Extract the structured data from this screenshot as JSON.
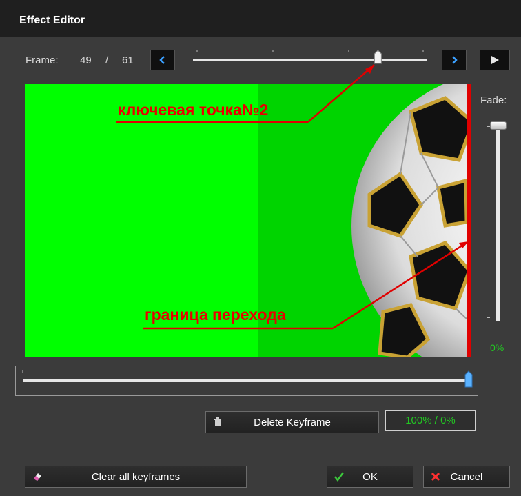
{
  "window": {
    "title": "Effect Editor"
  },
  "frame": {
    "label": "Frame:",
    "current": "49",
    "separator": "/",
    "total": "61"
  },
  "controls": {
    "prev_icon": "chevron-left-icon",
    "next_icon": "chevron-right-icon",
    "play_icon": "play-icon"
  },
  "timeline": {
    "position": 0.8
  },
  "preview": {
    "annotation_keypoint": "ключевая точка№2",
    "annotation_boundary": "граница перехода",
    "boundary_position": 1.0
  },
  "fade": {
    "label": "Fade:",
    "value": "0%",
    "level": 0.0
  },
  "transition_slider": {
    "position": 1.0
  },
  "buttons": {
    "delete_keyframe": "Delete Keyframe",
    "clear_all": "Clear all keyframes",
    "ok": "OK",
    "cancel": "Cancel"
  },
  "ratio": {
    "display": "100% / 0%"
  },
  "colors": {
    "accent_green": "#22c822",
    "annotation_red": "#e80000",
    "preview_green": "#00ff00",
    "slider_blue": "#4aa8ff"
  }
}
